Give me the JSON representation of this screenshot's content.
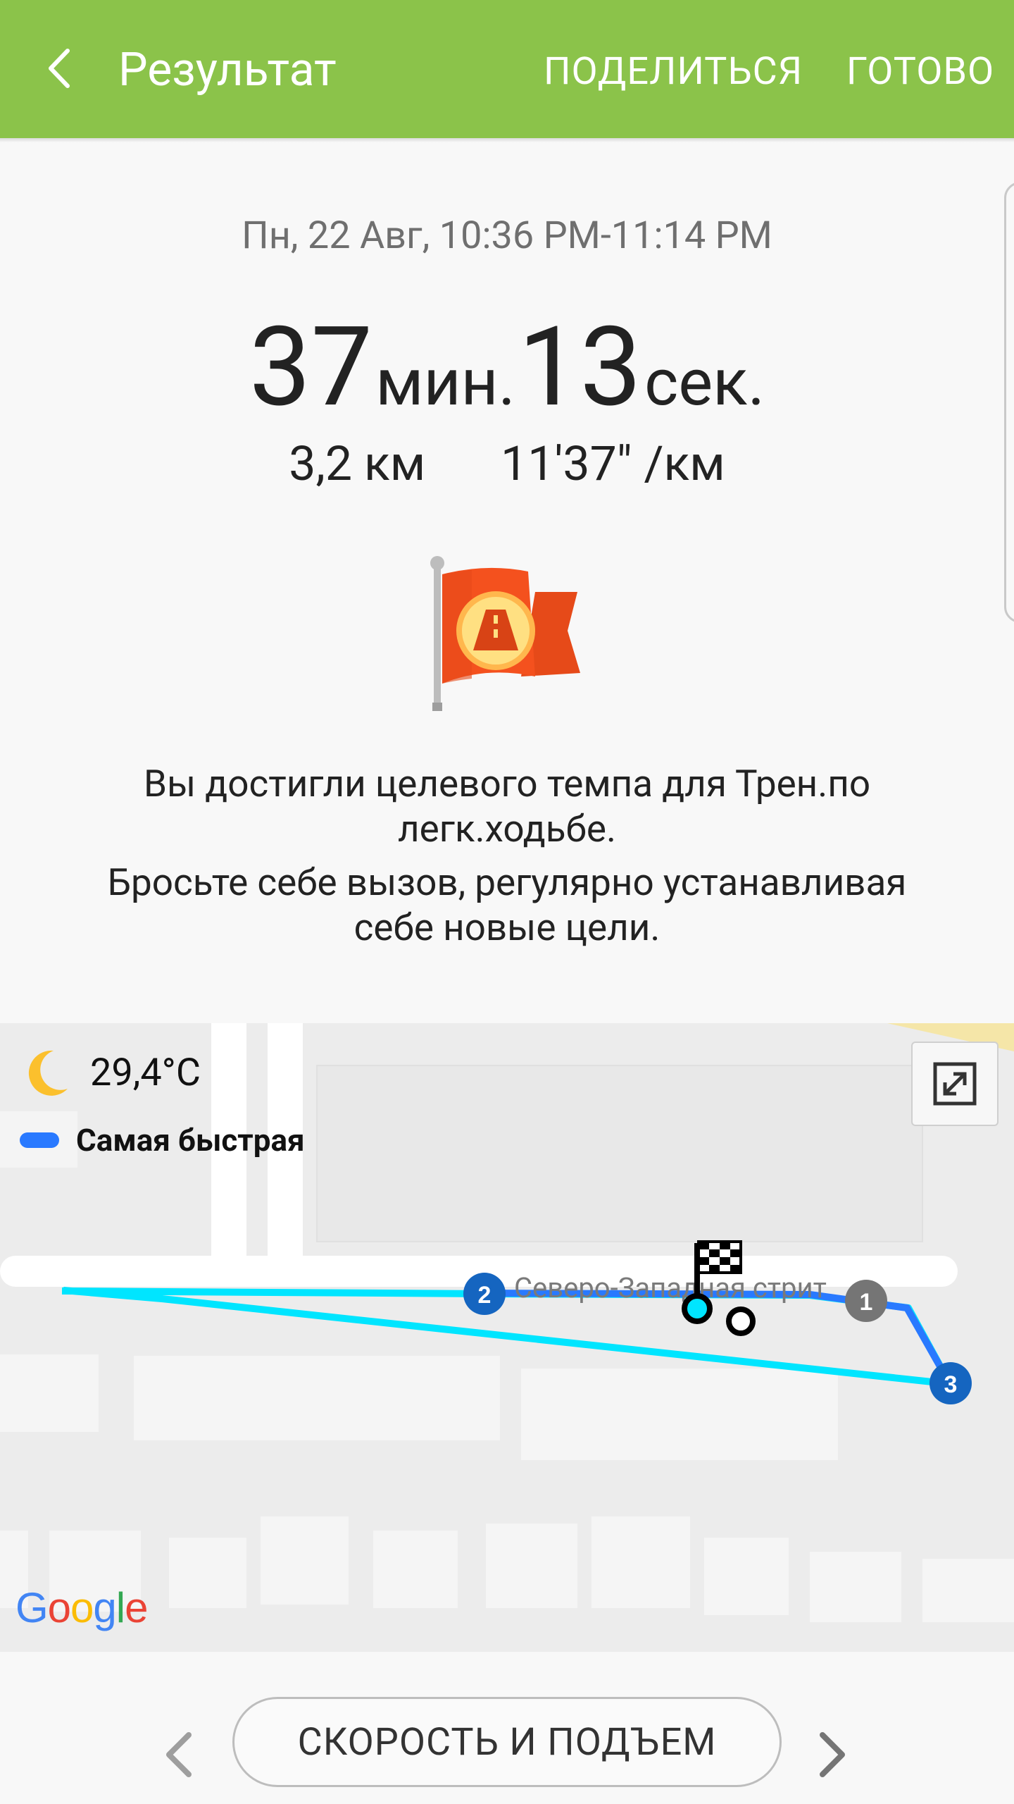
{
  "header": {
    "title": "Результат",
    "share_label": "ПОДЕЛИТЬСЯ",
    "done_label": "ГОТОВО",
    "back_icon": "back-arrow-icon",
    "color": "#8bc34a"
  },
  "summary": {
    "date": "Пн, 22 Авг, 10:36 PM-11:14 PM",
    "minutes": "37",
    "minutes_unit": "мин.",
    "seconds": "13",
    "seconds_unit": "сек.",
    "distance": "3,2 км",
    "pace": "11'37\" /км"
  },
  "achievement": {
    "icon": "achievement-flag-icon",
    "message_line1": "Вы достигли целевого темпа для Трен.по легк.ходьбе.",
    "message_line2": "Бросьте себе вызов, регулярно устанавливая себе новые цели."
  },
  "map": {
    "weather_icon": "moon-icon",
    "temperature": "29,4°C",
    "legend_label": "Самая быстрая",
    "legend_color": "#2979ff",
    "street_name": "Северо-Западная стрит",
    "route_color": "#00e5ff",
    "markers": [
      "1",
      "2",
      "3"
    ],
    "provider": "Google"
  },
  "footer": {
    "button_label": "СКОРОСТЬ И ПОДЪЕМ"
  }
}
